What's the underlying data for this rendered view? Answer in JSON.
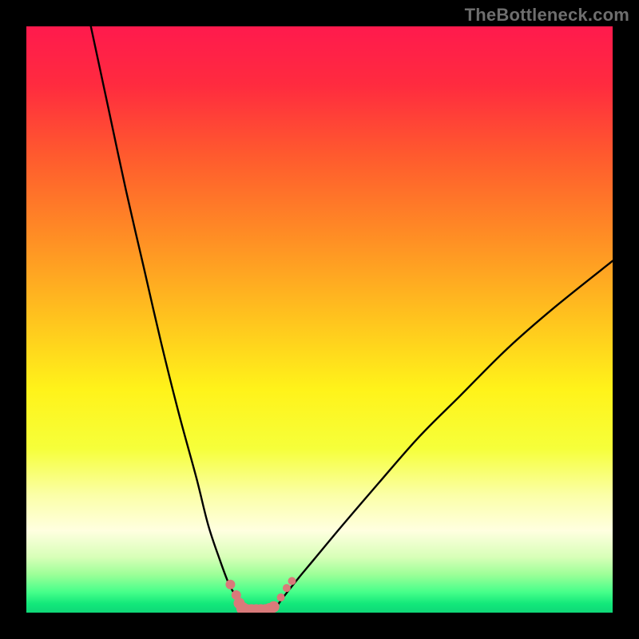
{
  "watermark": "TheBottleneck.com",
  "chart_data": {
    "type": "line",
    "title": "",
    "xlabel": "",
    "ylabel": "",
    "xlim": [
      0,
      100
    ],
    "ylim": [
      0,
      100
    ],
    "series": [
      {
        "name": "left-curve",
        "x": [
          11,
          14,
          17,
          20,
          23,
          26,
          29,
          31,
          33,
          34.5,
          35.6,
          36.3,
          37
        ],
        "y": [
          100,
          86,
          72,
          59,
          46,
          34,
          23,
          15,
          9,
          5,
          3,
          1.5,
          0
        ]
      },
      {
        "name": "right-curve",
        "x": [
          42,
          43,
          44.5,
          46.5,
          49,
          54,
          60,
          67,
          74,
          82,
          90,
          100
        ],
        "y": [
          0,
          1.5,
          3.5,
          6,
          9,
          15,
          22,
          30,
          37,
          45,
          52,
          60
        ]
      }
    ],
    "markers": {
      "name": "bottom-markers",
      "color": "#d97a7a",
      "points": [
        {
          "x": 34.8,
          "y": 4.8,
          "r": 6
        },
        {
          "x": 35.8,
          "y": 3.0,
          "r": 6
        },
        {
          "x": 36.3,
          "y": 1.6,
          "r": 7
        },
        {
          "x": 36.9,
          "y": 0.7,
          "r": 8
        },
        {
          "x": 37.6,
          "y": 0.35,
          "r": 8
        },
        {
          "x": 38.4,
          "y": 0.35,
          "r": 8
        },
        {
          "x": 39.2,
          "y": 0.35,
          "r": 8
        },
        {
          "x": 40.0,
          "y": 0.35,
          "r": 8
        },
        {
          "x": 40.8,
          "y": 0.35,
          "r": 8
        },
        {
          "x": 41.5,
          "y": 0.55,
          "r": 8
        },
        {
          "x": 42.2,
          "y": 1.0,
          "r": 7
        },
        {
          "x": 43.4,
          "y": 2.6,
          "r": 5
        },
        {
          "x": 44.4,
          "y": 4.2,
          "r": 5
        },
        {
          "x": 45.3,
          "y": 5.4,
          "r": 5
        }
      ]
    },
    "gradient_stops": [
      {
        "offset": 0.0,
        "color": "#ff1a4d"
      },
      {
        "offset": 0.1,
        "color": "#ff2b3f"
      },
      {
        "offset": 0.22,
        "color": "#ff5a2e"
      },
      {
        "offset": 0.35,
        "color": "#ff8a25"
      },
      {
        "offset": 0.5,
        "color": "#ffc41e"
      },
      {
        "offset": 0.62,
        "color": "#fff31a"
      },
      {
        "offset": 0.72,
        "color": "#f6ff3a"
      },
      {
        "offset": 0.8,
        "color": "#fbffa8"
      },
      {
        "offset": 0.86,
        "color": "#ffffe0"
      },
      {
        "offset": 0.905,
        "color": "#d8ffb8"
      },
      {
        "offset": 0.935,
        "color": "#9cff98"
      },
      {
        "offset": 0.965,
        "color": "#46ff8a"
      },
      {
        "offset": 0.985,
        "color": "#12e87a"
      },
      {
        "offset": 1.0,
        "color": "#0fd878"
      }
    ]
  }
}
